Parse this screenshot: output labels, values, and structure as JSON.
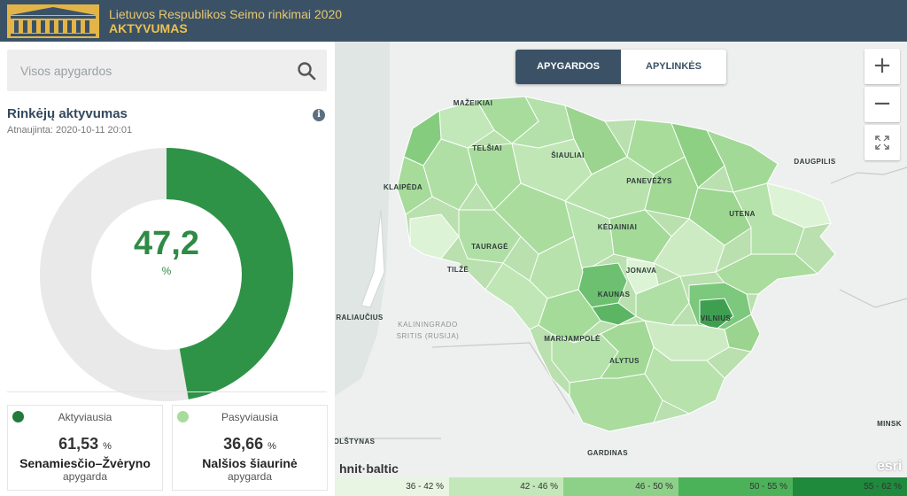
{
  "header": {
    "title": "Lietuvos Respublikos Seimo rinkimai 2020",
    "subtitle": "AKTYVUMAS",
    "logo_icon": "seimas-building-logo"
  },
  "sidebar": {
    "search": {
      "placeholder": "Visos apygardos",
      "icon": "search-icon"
    },
    "section_title": "Rinkėjų aktyvumas",
    "updated": "Atnaujinta: 2020-10-11 20:01",
    "turnout": {
      "value": "47,2",
      "unit": "%",
      "fraction": 0.472
    },
    "colors": {
      "filled": "#2e9347",
      "empty": "#e9e9e9"
    },
    "cards": [
      {
        "label": "Aktyviausia",
        "value": "61,53",
        "unit": "%",
        "name": "Senamiesčio–Žvėryno",
        "sub": "apygarda",
        "color": "#237a3a"
      },
      {
        "label": "Pasyviausia",
        "value": "36,66",
        "unit": "%",
        "name": "Nalšios šiaurinė",
        "sub": "apygarda",
        "color": "#a9dc9a"
      }
    ]
  },
  "map": {
    "toggle": {
      "active": "APYGARDOS",
      "inactive": "APYLINKĖS"
    },
    "zoom": {
      "in": "+",
      "out": "−",
      "fullscreen_icon": "expand-icon"
    },
    "labels": {
      "mazeikiai": "MAŽEIKIAI",
      "telsiai": "TELŠIAI",
      "siauliai": "ŠIAULIAI",
      "klaipeda": "KLAIPĖDA",
      "panevezys": "PANEVĖŽYS",
      "daugpilis": "DAUGPILIS",
      "utena": "UTENA",
      "taurage": "TAURAGĖ",
      "kedainiai": "KĖDAINIAI",
      "jonava": "JONAVA",
      "tilze": "TILŽĖ",
      "kaunas": "KAUNAS",
      "vilnius": "VILNIUS",
      "karaliaucius": "RALIAUČIUS",
      "kaliningrado": "KALININGRADO",
      "sritis": "SRITIS (RUSIJA)",
      "marijampole": "MARIJAMPOLĖ",
      "alytus": "ALYTUS",
      "minsk": "MINSK",
      "olstynas": "OLŠTYNAS",
      "gardinas": "GARDINAS"
    },
    "attribution": "hnit·baltic",
    "esri": "esri"
  },
  "legend": [
    {
      "label": "36 - 42 %",
      "color": "#e7f5e2"
    },
    {
      "label": "42 - 46 %",
      "color": "#c2e8b9"
    },
    {
      "label": "46 - 50 %",
      "color": "#8dd189"
    },
    {
      "label": "50 - 55 %",
      "color": "#4cb25a"
    },
    {
      "label": "55 - 62 %",
      "color": "#1f8a3c"
    }
  ]
}
